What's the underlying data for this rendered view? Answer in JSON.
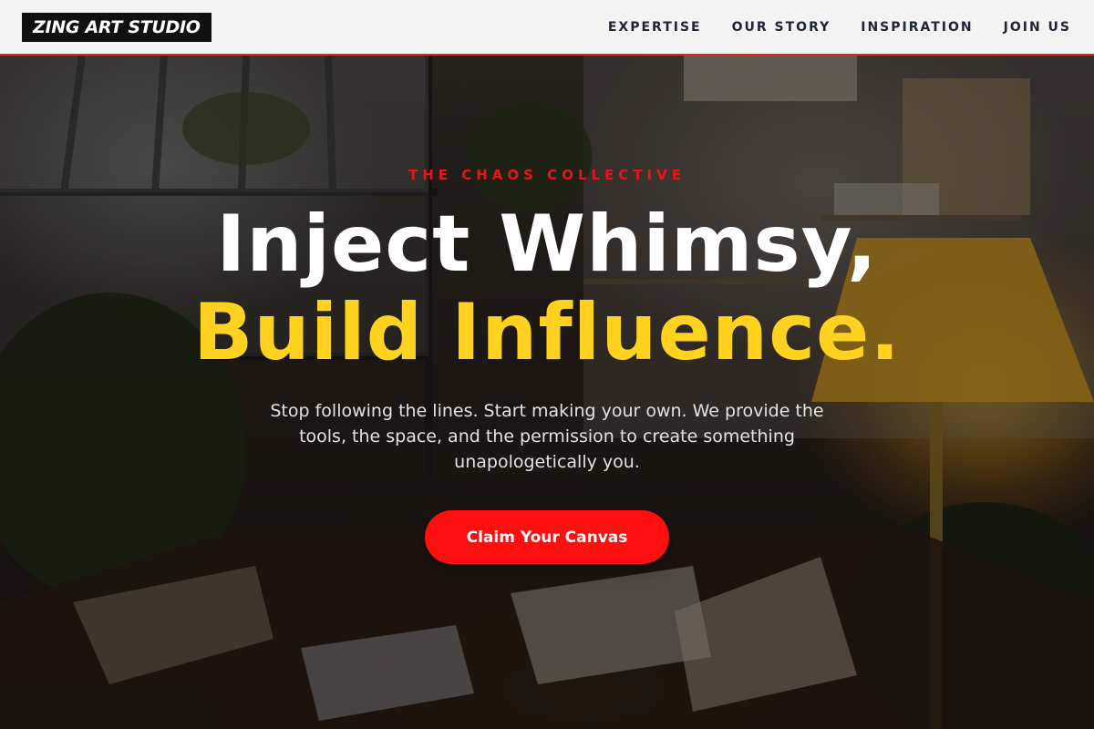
{
  "header": {
    "logo": "ZING ART STUDIO",
    "nav": [
      {
        "label": "EXPERTISE"
      },
      {
        "label": "OUR STORY"
      },
      {
        "label": "INSPIRATION"
      },
      {
        "label": "JOIN US"
      }
    ]
  },
  "hero": {
    "eyebrow": "THE CHAOS COLLECTIVE",
    "headline_line1": "Inject Whimsy,",
    "headline_line2": "Build Influence.",
    "subtext": "Stop following the lines. Start making your own. We provide the tools, the space, and the permission to create something unapologetically you.",
    "cta_label": "Claim Your Canvas",
    "background_image": "art-studio-photo"
  },
  "colors": {
    "accent_red": "#ff0f0f",
    "eyebrow_red": "#e8141a",
    "highlight_yellow": "#ffd21f",
    "header_bg": "#f3f3f3",
    "logo_bg": "#111111"
  }
}
